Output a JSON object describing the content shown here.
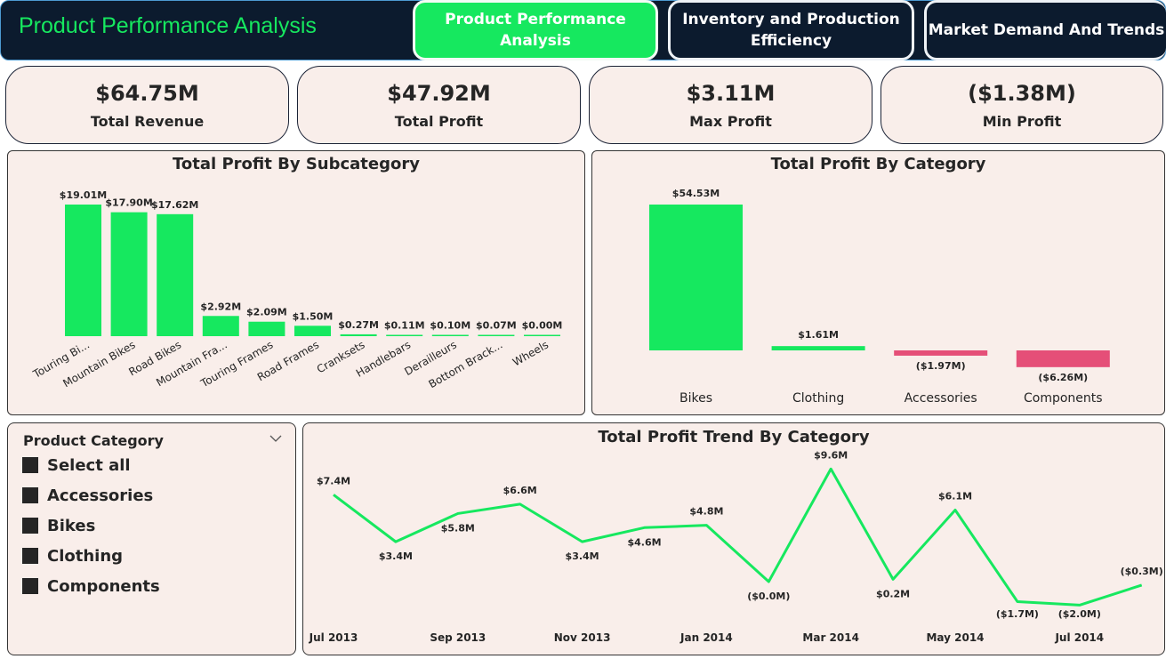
{
  "header": {
    "title": "Product Performance Analysis",
    "nav": {
      "product_performance": "Product Performance Analysis",
      "inventory_production": "Inventory and Production Efficiency",
      "market_demand": "Market Demand And Trends"
    }
  },
  "kpis": [
    {
      "value": "$64.75M",
      "label": "Total Revenue"
    },
    {
      "value": "$47.92M",
      "label": "Total Profit"
    },
    {
      "value": "$3.11M",
      "label": "Max Profit"
    },
    {
      "value": "($1.38M)",
      "label": "Min Profit"
    }
  ],
  "colors": {
    "positive": "#16e85f",
    "negative": "#e54f78",
    "dark": "#0c1b2e",
    "card_bg": "#f9eeea"
  },
  "slicer": {
    "title": "Product Category",
    "icon": "chevron-down-icon",
    "items": [
      "Select all",
      "Accessories",
      "Bikes",
      "Clothing",
      "Components"
    ]
  },
  "chart_data": [
    {
      "type": "bar",
      "title": "Total Profit By Subcategory",
      "categories": [
        "Touring Bi...",
        "Mountain Bikes",
        "Road Bikes",
        "Mountain Fra...",
        "Touring Frames",
        "Road Frames",
        "Cranksets",
        "Handlebars",
        "Derailleurs",
        "Bottom Brack...",
        "Wheels"
      ],
      "values": [
        19.01,
        17.9,
        17.62,
        2.92,
        2.09,
        1.5,
        0.27,
        0.11,
        0.1,
        0.07,
        0.0
      ],
      "data_labels": [
        "$19.01M",
        "$17.90M",
        "$17.62M",
        "$2.92M",
        "$2.09M",
        "$1.50M",
        "$0.27M",
        "$0.11M",
        "$0.10M",
        "$0.07M",
        "$0.00M"
      ],
      "units": "millions USD",
      "grid": false
    },
    {
      "type": "bar",
      "title": "Total Profit By Category",
      "categories": [
        "Bikes",
        "Clothing",
        "Accessories",
        "Components"
      ],
      "values": [
        54.53,
        1.61,
        -1.97,
        -6.26
      ],
      "data_labels": [
        "$54.53M",
        "$1.61M",
        "($1.97M)",
        "($6.26M)"
      ],
      "units": "millions USD",
      "grid": false
    },
    {
      "type": "line",
      "title": "Total Profit Trend By Category",
      "x": [
        "Jul 2013",
        "Aug 2013",
        "Sep 2013",
        "Oct 2013",
        "Nov 2013",
        "Dec 2013",
        "Jan 2014",
        "Feb 2014",
        "Mar 2014",
        "Apr 2014",
        "May 2014",
        "Jun 2014",
        "Jul 2014",
        "Aug 2014"
      ],
      "x_ticks": [
        "Jul 2013",
        "Sep 2013",
        "Nov 2013",
        "Jan 2014",
        "Mar 2014",
        "May 2014",
        "Jul 2014"
      ],
      "values": [
        7.4,
        3.4,
        5.8,
        6.6,
        3.4,
        4.6,
        4.8,
        0.0,
        9.6,
        0.2,
        6.1,
        -1.7,
        -2.0,
        -0.3
      ],
      "data_labels": [
        "$7.4M",
        "$3.4M",
        "$5.8M",
        "$6.6M",
        "$3.4M",
        "$4.6M",
        "$4.8M",
        "($0.0M)",
        "$9.6M",
        "$0.2M",
        "$6.1M",
        "($1.7M)",
        "($2.0M)",
        "($0.3M)"
      ],
      "units": "millions USD",
      "grid": false
    }
  ]
}
